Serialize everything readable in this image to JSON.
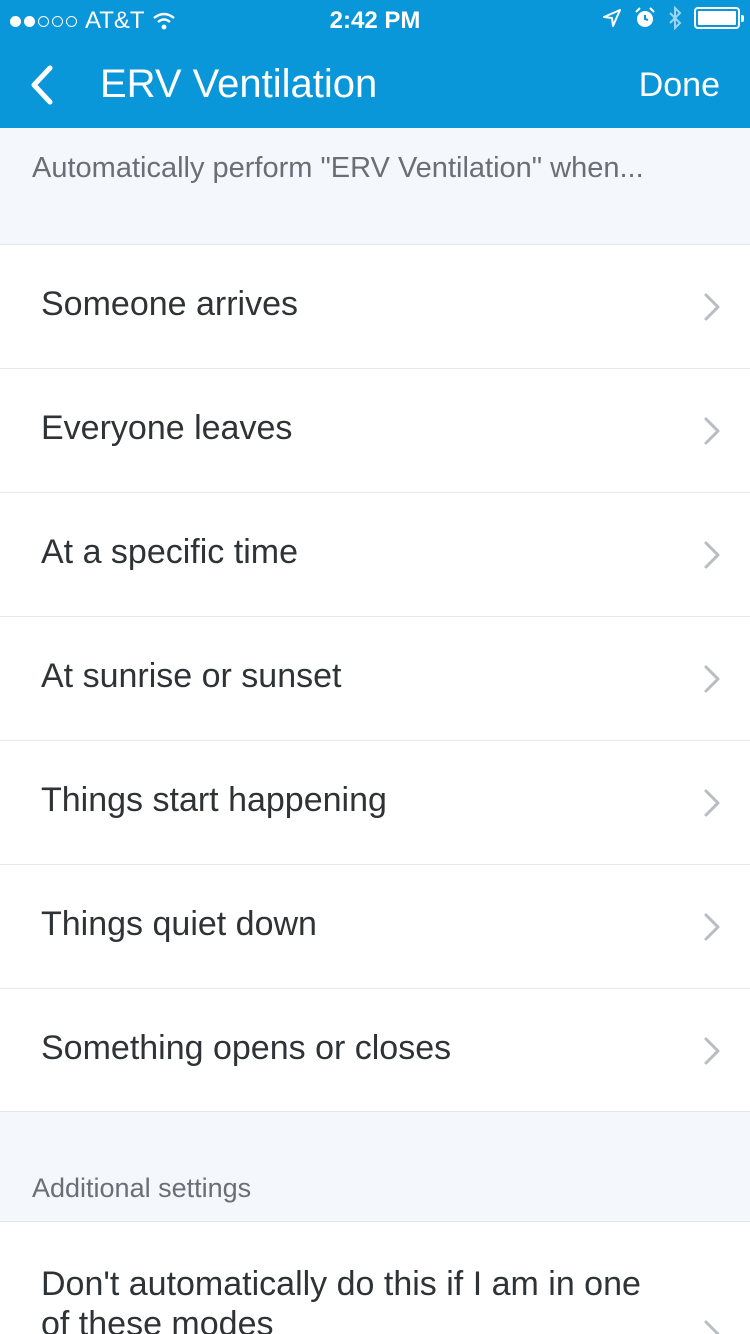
{
  "status_bar": {
    "carrier": "AT&T",
    "time": "2:42 PM",
    "signal_filled": 2,
    "signal_total": 5
  },
  "nav": {
    "title": "ERV Ventilation",
    "done_label": "Done",
    "back_icon": "chevron-left-icon"
  },
  "intro_text": "Automatically perform \"ERV Ventilation\" when...",
  "triggers": [
    {
      "label": "Someone arrives"
    },
    {
      "label": "Everyone leaves"
    },
    {
      "label": "At a specific time"
    },
    {
      "label": "At sunrise or sunset"
    },
    {
      "label": "Things start happening"
    },
    {
      "label": "Things quiet down"
    },
    {
      "label": "Something opens or closes"
    }
  ],
  "additional_settings": {
    "header": "Additional settings",
    "items": [
      {
        "label": "Don't automatically do this if I am in one of these modes"
      }
    ]
  },
  "colors": {
    "accent": "#0a97d9",
    "section_bg": "#f4f7fb",
    "text": "#2f3336",
    "chevron": "#b9bdc2"
  }
}
